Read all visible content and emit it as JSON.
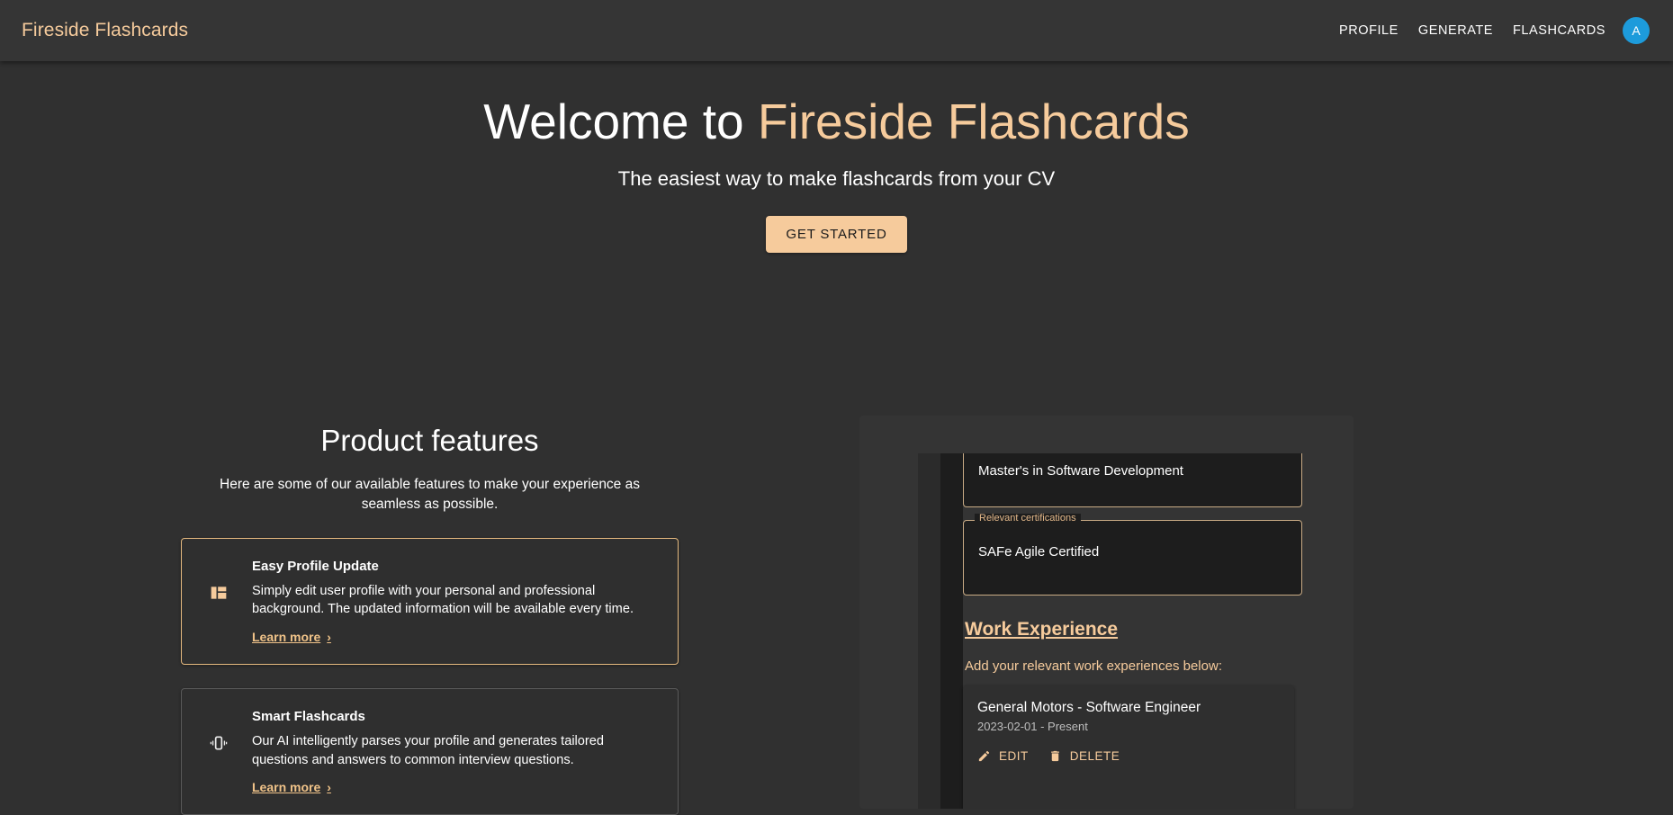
{
  "header": {
    "brand": "Fireside Flashcards",
    "nav": [
      {
        "label": "PROFILE",
        "name": "nav-profile"
      },
      {
        "label": "GENERATE",
        "name": "nav-generate"
      },
      {
        "label": "FLASHCARDS",
        "name": "nav-flashcards"
      }
    ],
    "avatar_initial": "A",
    "avatar_color": "#1d9bdb"
  },
  "hero": {
    "title_plain": "Welcome to ",
    "title_accent": "Fireside Flashcards",
    "subtitle": "The easiest way to make flashcards from your CV",
    "cta_label": "GET STARTED"
  },
  "features": {
    "title": "Product features",
    "subtitle": "Here are some of our available features to make your experience as seamless as possible.",
    "cards": [
      {
        "icon": "dashboard-layout-icon",
        "title": "Easy Profile Update",
        "text": "Simply edit user profile with your personal and professional background. The updated information will be available every time.",
        "link_label": "Learn more",
        "link_chevron": "›"
      },
      {
        "icon": "vibrating-phone-icon",
        "title": "Smart Flashcards",
        "text": "Our AI intelligently parses your profile and generates tailored questions and answers to common interview questions.",
        "link_label": "Learn more",
        "link_chevron": "›"
      }
    ]
  },
  "preview": {
    "field_degree": {
      "value": "Master's in Software Development"
    },
    "field_certifications": {
      "label": "Relevant certifications",
      "value": "SAFe Agile Certified"
    },
    "work_section": {
      "heading": "Work Experience",
      "note": "Add your relevant work experiences below:",
      "entries": [
        {
          "title": "General Motors - Software Engineer",
          "dates": "2023-02-01 - Present",
          "edit_label": "EDIT",
          "delete_label": "DELETE"
        }
      ]
    }
  },
  "colors": {
    "accent": "#f6cb9c",
    "page_bg": "#303030",
    "appbar_bg": "#353535",
    "card_bg": "#2f2f2f"
  }
}
